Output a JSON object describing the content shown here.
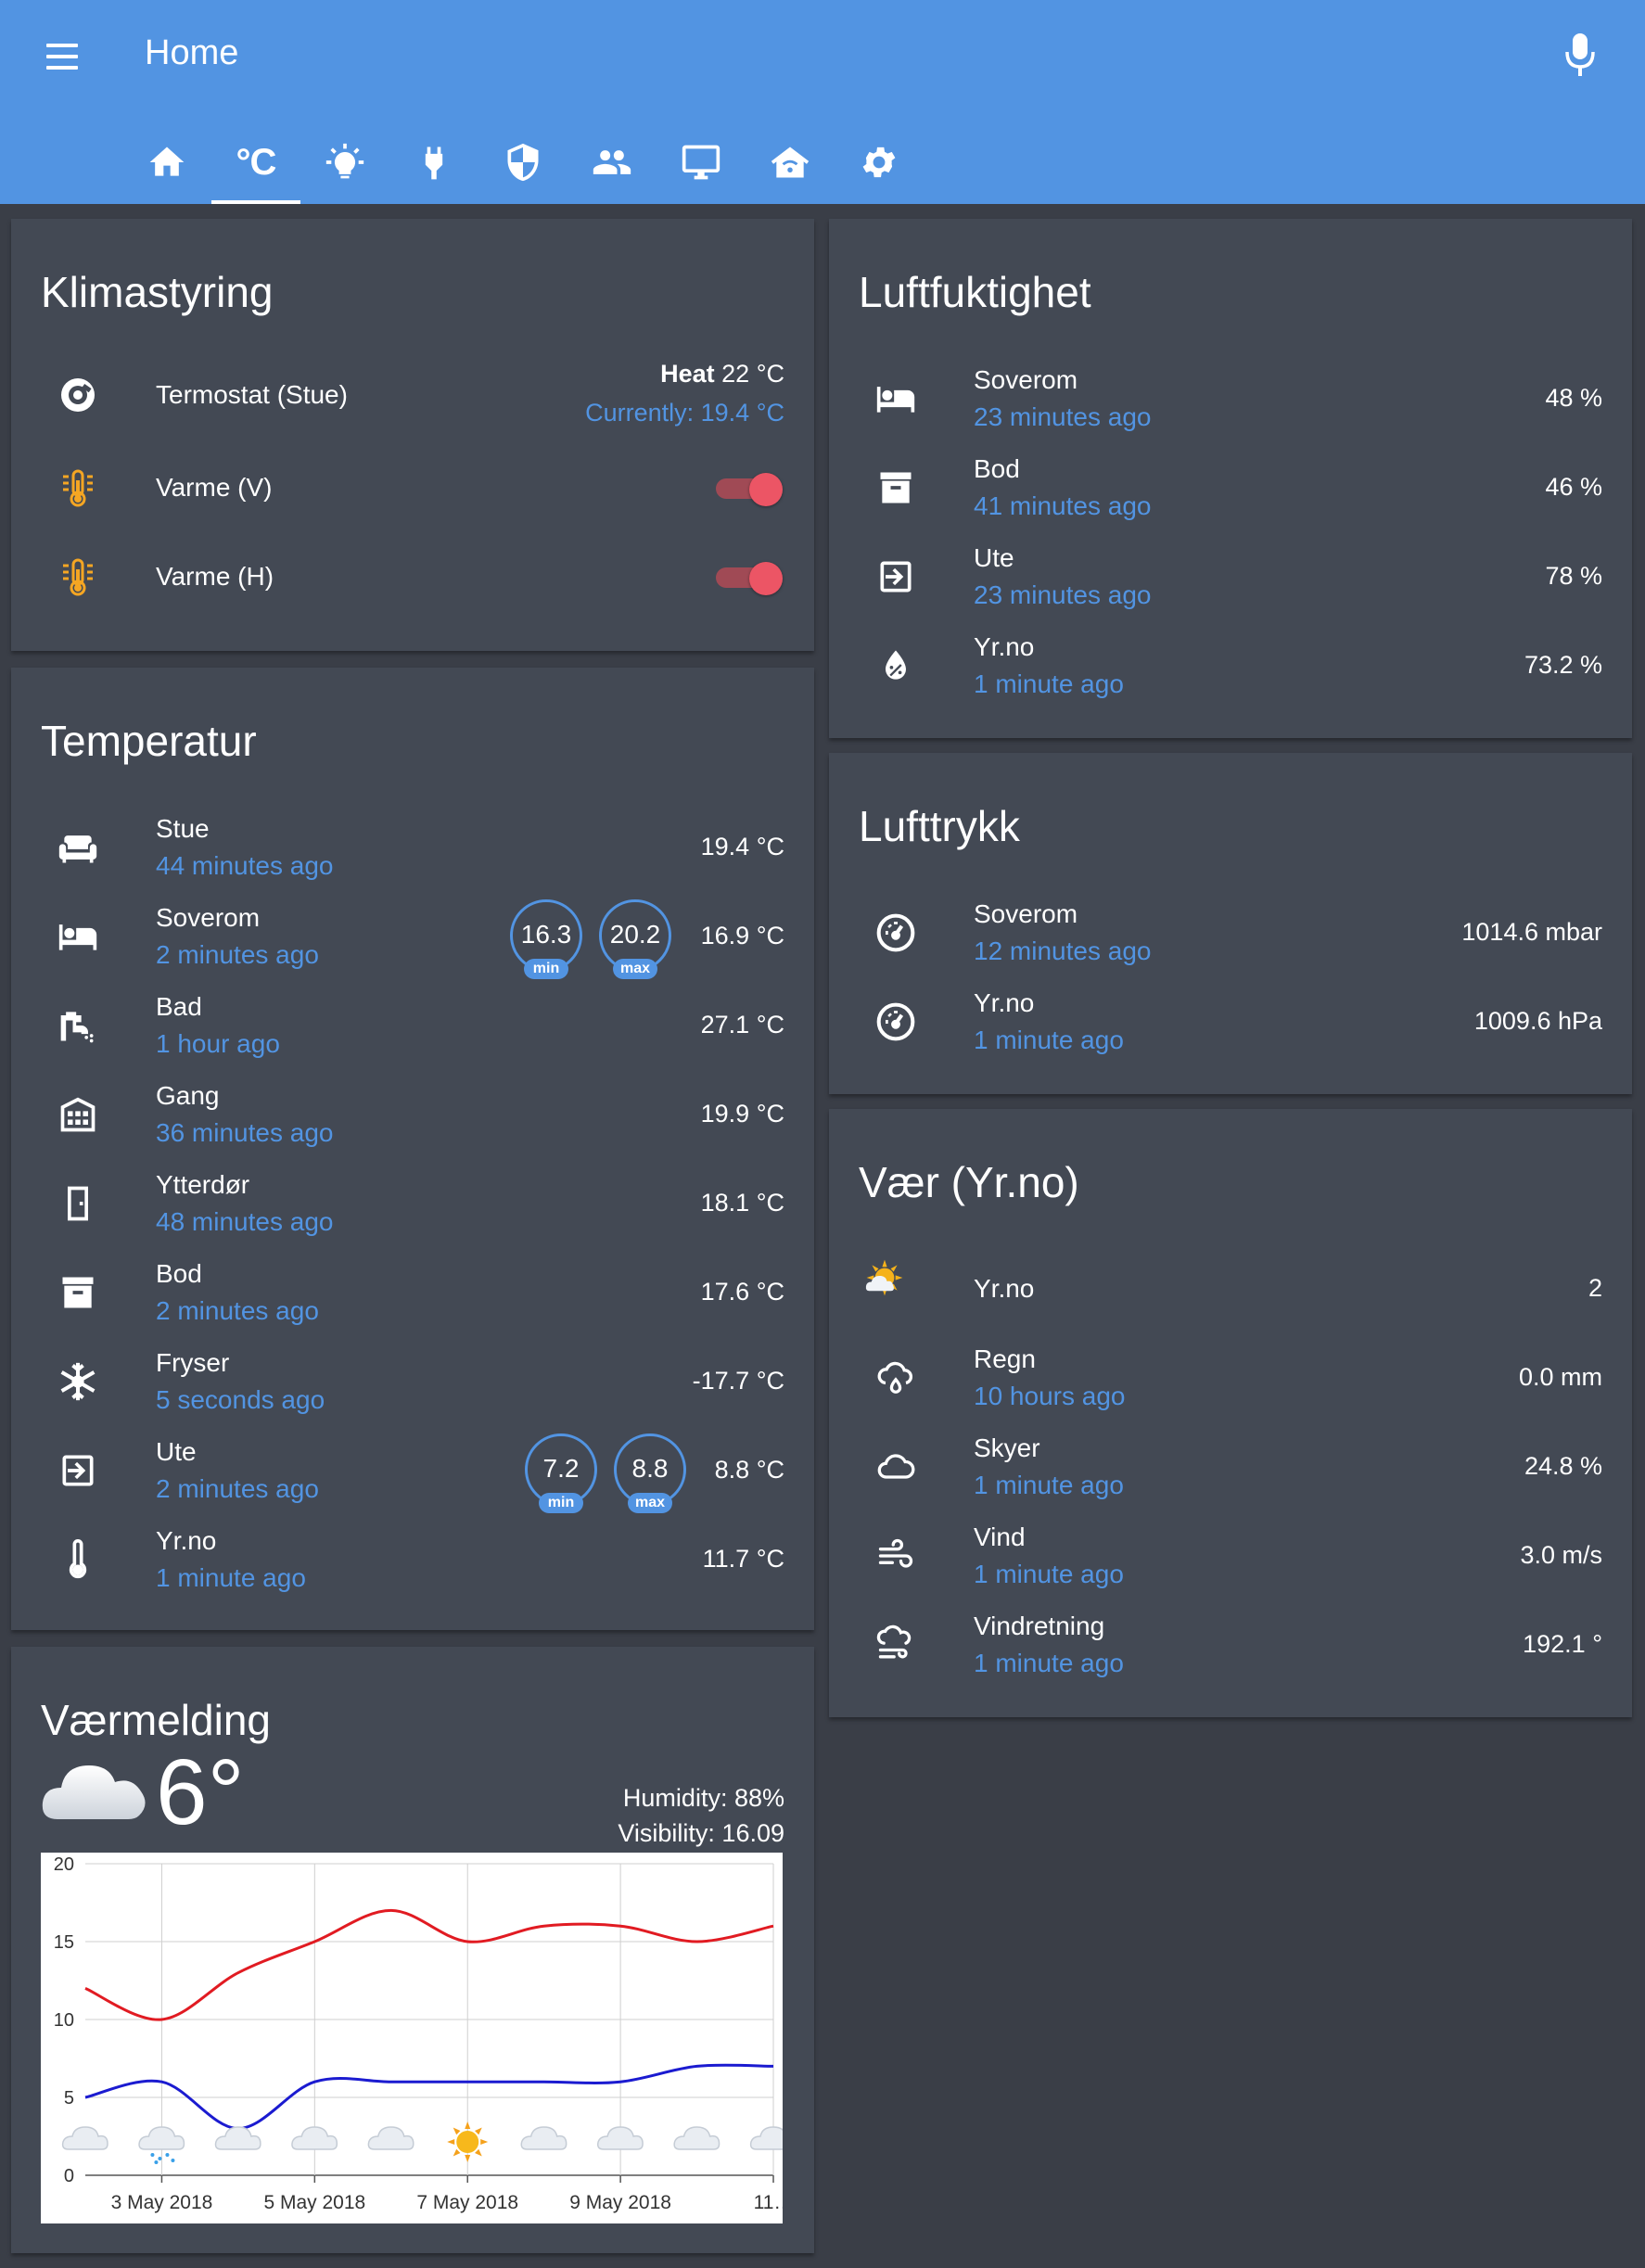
{
  "header": {
    "title": "Home",
    "tabs": [
      {
        "icon": "home-icon",
        "label": ""
      },
      {
        "icon": "celsius-icon",
        "label": "°C",
        "active": true
      },
      {
        "icon": "lightbulb-icon",
        "label": ""
      },
      {
        "icon": "power-plug-icon",
        "label": ""
      },
      {
        "icon": "shield-icon",
        "label": ""
      },
      {
        "icon": "people-icon",
        "label": ""
      },
      {
        "icon": "monitor-icon",
        "label": ""
      },
      {
        "icon": "home-wifi-icon",
        "label": ""
      },
      {
        "icon": "gear-icon",
        "label": ""
      }
    ]
  },
  "colors": {
    "primary": "#5294e2",
    "background": "#3a3e47",
    "card": "#434954",
    "toggle_on": "#ec5565",
    "heat_icon": "#f5a623",
    "high_temp_line": "#e11b22",
    "low_temp_line": "#1b1bd0"
  },
  "klima": {
    "title": "Klimastyring",
    "thermostat": {
      "name": "Termostat (Stue)",
      "mode": "Heat",
      "target": "22 °C",
      "current": "Currently: 19.4 °C",
      "icon": "thermostat-icon"
    },
    "switches": [
      {
        "name": "Varme (V)",
        "on": true,
        "icon": "heater-icon"
      },
      {
        "name": "Varme (H)",
        "on": true,
        "icon": "heater-icon"
      }
    ]
  },
  "temperatur": {
    "title": "Temperatur",
    "rows": [
      {
        "name": "Stue",
        "time": "44 minutes ago",
        "value": "19.4 °C",
        "icon": "sofa-icon"
      },
      {
        "name": "Soverom",
        "time": "2 minutes ago",
        "value": "16.9 °C",
        "icon": "bed-icon",
        "min": "16.3",
        "max": "20.2"
      },
      {
        "name": "Bad",
        "time": "1 hour ago",
        "value": "27.1 °C",
        "icon": "shower-icon"
      },
      {
        "name": "Gang",
        "time": "36 minutes ago",
        "value": "19.9 °C",
        "icon": "building-icon"
      },
      {
        "name": "Ytterdør",
        "time": "48 minutes ago",
        "value": "18.1 °C",
        "icon": "door-icon"
      },
      {
        "name": "Bod",
        "time": "2 minutes ago",
        "value": "17.6 °C",
        "icon": "archive-icon"
      },
      {
        "name": "Fryser",
        "time": "5 seconds ago",
        "value": "-17.7 °C",
        "icon": "snowflake-icon"
      },
      {
        "name": "Ute",
        "time": "2 minutes ago",
        "value": "8.8 °C",
        "icon": "exit-icon",
        "min": "7.2",
        "max": "8.8"
      },
      {
        "name": "Yr.no",
        "time": "1 minute ago",
        "value": "11.7 °C",
        "icon": "thermometer-icon"
      }
    ],
    "min_label": "min",
    "max_label": "max"
  },
  "vaermelding": {
    "title": "Værmelding",
    "temperature": "6°",
    "humidity": "Humidity: 88%",
    "visibility": "Visibility: 16.09",
    "icon": "cloud-icon"
  },
  "chart_data": {
    "type": "line",
    "title": "",
    "xlabel": "",
    "ylabel": "",
    "ylim": [
      0,
      20
    ],
    "yticks": [
      "0",
      "5",
      "10",
      "15",
      "20"
    ],
    "xtick_labels": [
      "3 May 2018",
      "5 May 2018",
      "7 May 2018",
      "9 May 2018",
      "11…"
    ],
    "categories": [
      "2 May",
      "3 May",
      "4 May",
      "5 May",
      "6 May",
      "7 May",
      "8 May",
      "9 May",
      "10 May",
      "11 May"
    ],
    "series": [
      {
        "name": "",
        "color": "#e11b22",
        "values": [
          12,
          10,
          13,
          15,
          17,
          15,
          16,
          16,
          15,
          16
        ]
      },
      {
        "name": "",
        "color": "#1b1bd0",
        "values": [
          5,
          6,
          3,
          6,
          6,
          6,
          6,
          6,
          7,
          7
        ]
      }
    ],
    "condition_icons": [
      "cloud-icon",
      "snow-rain-icon",
      "cloud-icon",
      "cloud-icon",
      "cloud-icon",
      "sun-icon",
      "cloud-icon",
      "cloud-icon",
      "cloud-icon",
      "cloud-icon"
    ],
    "grid": true
  },
  "luftfukt": {
    "title": "Luftfuktighet",
    "rows": [
      {
        "name": "Soverom",
        "time": "23 minutes ago",
        "value": "48 %",
        "icon": "bed-icon"
      },
      {
        "name": "Bod",
        "time": "41 minutes ago",
        "value": "46 %",
        "icon": "archive-icon"
      },
      {
        "name": "Ute",
        "time": "23 minutes ago",
        "value": "78 %",
        "icon": "exit-icon"
      },
      {
        "name": "Yr.no",
        "time": "1 minute ago",
        "value": "73.2 %",
        "icon": "water-percent-icon"
      }
    ]
  },
  "lufttrykk": {
    "title": "Lufttrykk",
    "rows": [
      {
        "name": "Soverom",
        "time": "12 minutes ago",
        "value": "1014.6 mbar",
        "icon": "gauge-icon"
      },
      {
        "name": "Yr.no",
        "time": "1 minute ago",
        "value": "1009.6 hPa",
        "icon": "gauge-icon"
      }
    ]
  },
  "vaer": {
    "title": "Vær (Yr.no)",
    "rows": [
      {
        "name": "Yr.no",
        "time": "",
        "value": "2",
        "icon": "partly-sunny-icon"
      },
      {
        "name": "Regn",
        "time": "10 hours ago",
        "value": "0.0 mm",
        "icon": "rain-cloud-icon"
      },
      {
        "name": "Skyer",
        "time": "1 minute ago",
        "value": "24.8 %",
        "icon": "cloud-outline-icon"
      },
      {
        "name": "Vind",
        "time": "1 minute ago",
        "value": "3.0 m/s",
        "icon": "wind-icon"
      },
      {
        "name": "Vindretning",
        "time": "1 minute ago",
        "value": "192.1 °",
        "icon": "windy-cloud-icon"
      }
    ]
  }
}
